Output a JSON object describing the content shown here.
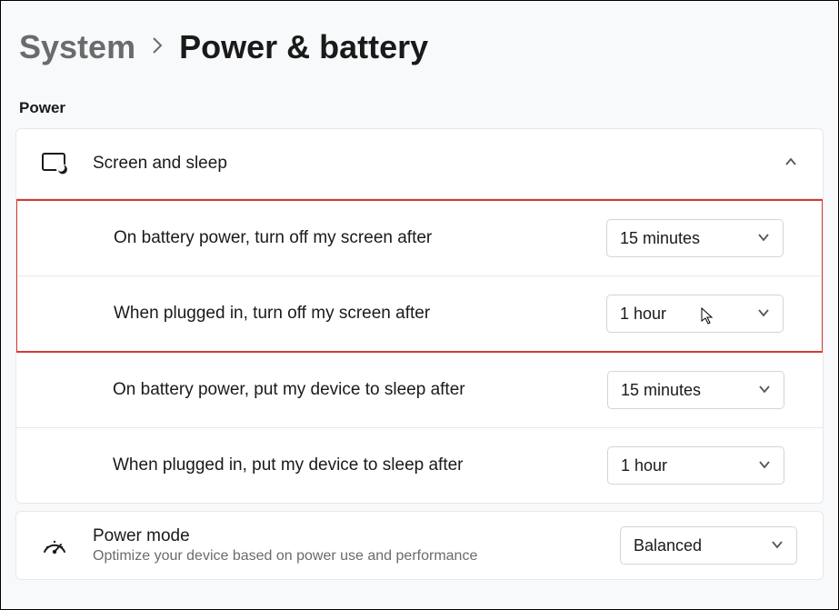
{
  "breadcrumb": {
    "parent": "System",
    "current": "Power & battery"
  },
  "section_label": "Power",
  "screen_sleep": {
    "title": "Screen and sleep",
    "rows": [
      {
        "label": "On battery power, turn off my screen after",
        "value": "15 minutes"
      },
      {
        "label": "When plugged in, turn off my screen after",
        "value": "1 hour"
      },
      {
        "label": "On battery power, put my device to sleep after",
        "value": "15 minutes"
      },
      {
        "label": "When plugged in, put my device to sleep after",
        "value": "1 hour"
      }
    ]
  },
  "power_mode": {
    "title": "Power mode",
    "subtitle": "Optimize your device based on power use and performance",
    "value": "Balanced"
  }
}
